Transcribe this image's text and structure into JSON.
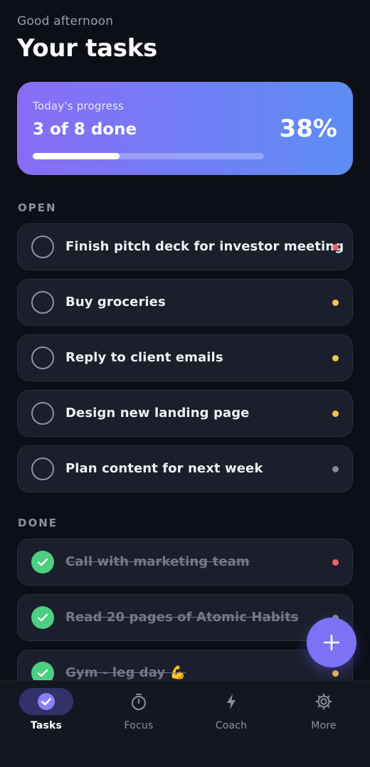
{
  "header": {
    "greeting": "Good afternoon",
    "title": "Your tasks"
  },
  "progress": {
    "label": "Today's progress",
    "count_text": "3 of 8 done",
    "percent_text": "38%",
    "fraction": 0.375
  },
  "sections": {
    "open_label": "OPEN",
    "done_label": "DONE"
  },
  "open_tasks": [
    {
      "text": "Finish pitch deck for investor meeting",
      "priority_color": "#f0636b"
    },
    {
      "text": "Buy groceries",
      "priority_color": "#f7c244"
    },
    {
      "text": "Reply to client emails",
      "priority_color": "#f7c244"
    },
    {
      "text": "Design new landing page",
      "priority_color": "#f7c244"
    },
    {
      "text": "Plan content for next week",
      "priority_color": "#868a97"
    }
  ],
  "done_tasks": [
    {
      "text": "Call with marketing team",
      "priority_color": "#f0636b"
    },
    {
      "text": "Read 20 pages of Atomic Habits",
      "priority_color": "#868a97"
    },
    {
      "text": "Gym - leg day 💪",
      "priority_color": "#f7c244"
    }
  ],
  "fab": {
    "icon": "plus-icon"
  },
  "nav": {
    "items": [
      {
        "label": "Tasks",
        "icon": "check-circle-icon",
        "active": true
      },
      {
        "label": "Focus",
        "icon": "timer-icon",
        "active": false
      },
      {
        "label": "Coach",
        "icon": "bolt-icon",
        "active": false
      },
      {
        "label": "More",
        "icon": "gear-icon",
        "active": false
      }
    ]
  },
  "colors": {
    "background": "#0d0f16",
    "card": "#1b1f2b",
    "accent": "#7b72f6",
    "done_green": "#4ccf83",
    "gradient_start": "#8a6cf6",
    "gradient_end": "#5e8df4"
  }
}
